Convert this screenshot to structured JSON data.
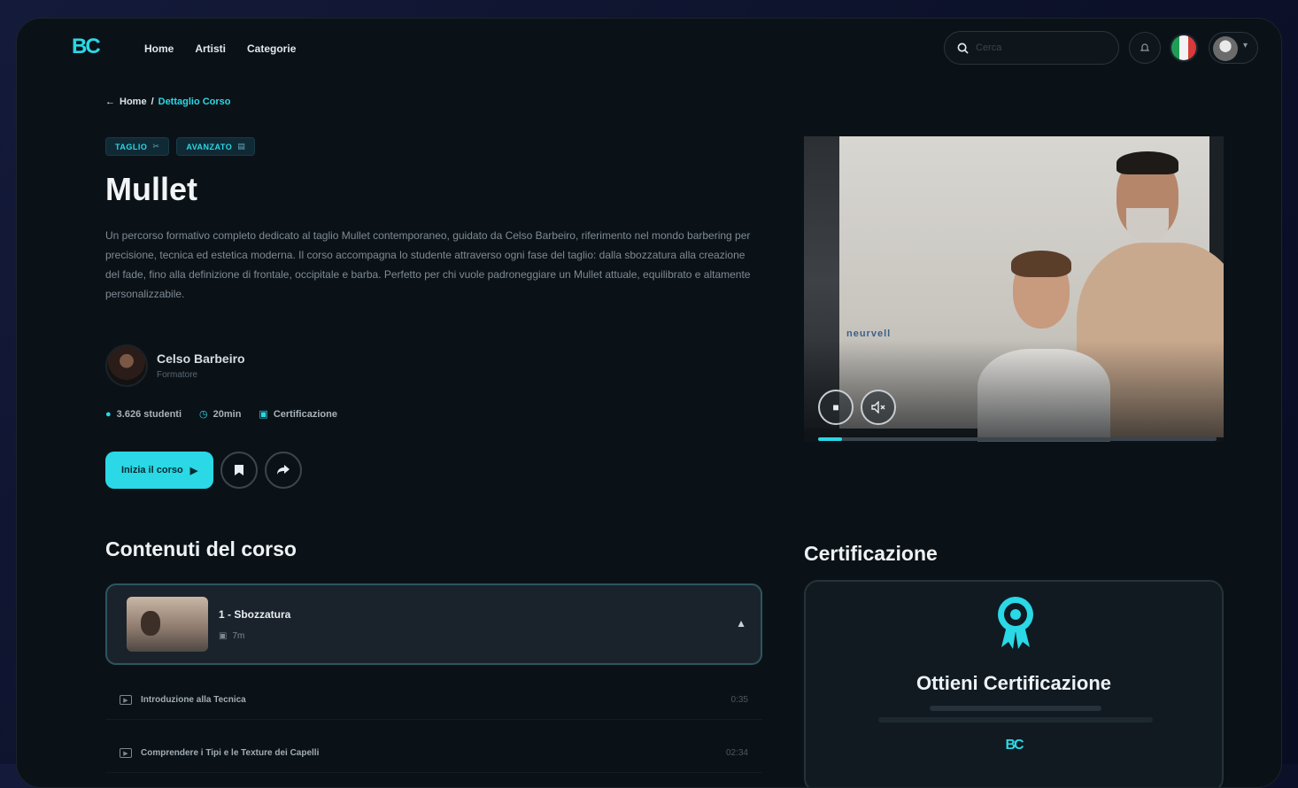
{
  "brand": {
    "logo": "BC",
    "accent_color": "#2ad8e6"
  },
  "nav": {
    "links": [
      "Home",
      "Artisti",
      "Categorie"
    ]
  },
  "search": {
    "placeholder": "Cerca"
  },
  "breadcrumb": {
    "home": "Home",
    "separator": "/",
    "current": "Dettaglio Corso"
  },
  "tags": [
    "TAGLIO",
    "AVANZATO"
  ],
  "course": {
    "title": "Mullet",
    "description": "Un percorso formativo completo dedicato al taglio Mullet contemporaneo, guidato da Celso Barbeiro, riferimento nel mondo barbering per precisione, tecnica ed estetica moderna. Il corso accompagna lo studente attraverso ogni fase del taglio: dalla sbozzatura alla creazione del fade, fino alla definizione di frontale, occipitale e barba. Perfetto per chi vuole padroneggiare un Mullet attuale, equilibrato e altamente personalizzabile."
  },
  "instructor": {
    "name": "Celso Barbeiro",
    "role": "Formatore"
  },
  "stats": {
    "students": "3.626 studenti",
    "duration": "20min",
    "certification": "Certificazione"
  },
  "actions": {
    "start_label": "Inizia il corso"
  },
  "video": {
    "brand_text": "neurvell",
    "progress": 0.06
  },
  "contents": {
    "title": "Contenuti del corso",
    "module": {
      "title": "1 - Sbozzatura",
      "meta": "7m"
    },
    "lessons": [
      {
        "title": "Introduzione alla Tecnica",
        "duration": "0:35"
      },
      {
        "title": "Comprendere i Tipi e le Texture dei Capelli",
        "duration": "02:34"
      }
    ]
  },
  "certification": {
    "section_title": "Certificazione",
    "card_title": "Ottieni Certificazione",
    "logo": "BC"
  }
}
